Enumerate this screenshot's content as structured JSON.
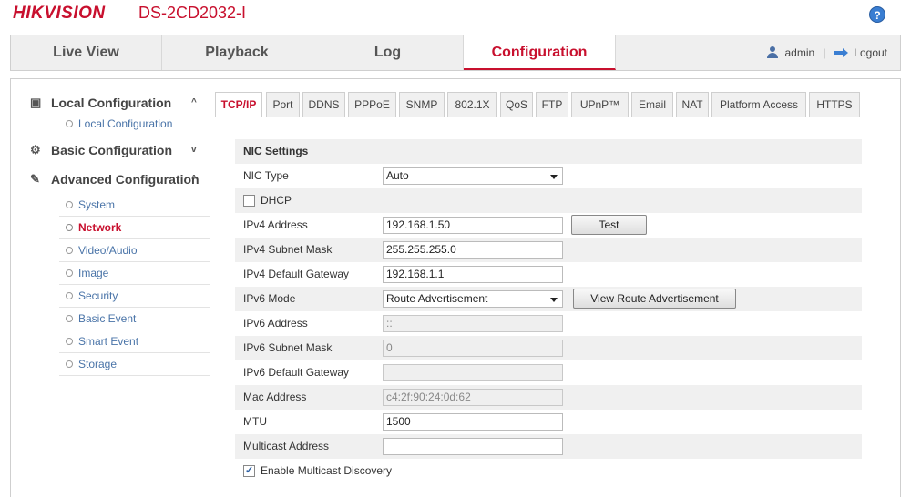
{
  "header": {
    "brand": "HIKVISION",
    "model": "DS-2CD2032-I",
    "help_label": "?"
  },
  "mainnav": {
    "tabs": [
      {
        "label": "Live View"
      },
      {
        "label": "Playback"
      },
      {
        "label": "Log"
      },
      {
        "label": "Configuration"
      }
    ],
    "user": "admin",
    "separator": "|",
    "logout": "Logout"
  },
  "sidebar": {
    "local": {
      "label": "Local Configuration",
      "chevron": "^",
      "items": [
        "Local Configuration"
      ]
    },
    "basic": {
      "label": "Basic Configuration",
      "chevron": "v"
    },
    "advanced": {
      "label": "Advanced Configuration",
      "chevron": "^",
      "items": [
        "System",
        "Network",
        "Video/Audio",
        "Image",
        "Security",
        "Basic Event",
        "Smart Event",
        "Storage"
      ]
    }
  },
  "subtabs": [
    "TCP/IP",
    "Port",
    "DDNS",
    "PPPoE",
    "SNMP",
    "802.1X",
    "QoS",
    "FTP",
    "UPnP™",
    "Email",
    "NAT",
    "Platform Access",
    "HTTPS"
  ],
  "form": {
    "section_title": "NIC Settings",
    "nic_type": {
      "label": "NIC Type",
      "value": "Auto"
    },
    "dhcp": {
      "label": "DHCP",
      "checked": false
    },
    "ipv4_address": {
      "label": "IPv4 Address",
      "value": "192.168.1.50",
      "button": "Test"
    },
    "ipv4_subnet": {
      "label": "IPv4 Subnet Mask",
      "value": "255.255.255.0"
    },
    "ipv4_gateway": {
      "label": "IPv4 Default Gateway",
      "value": "192.168.1.1"
    },
    "ipv6_mode": {
      "label": "IPv6 Mode",
      "value": "Route Advertisement",
      "button": "View Route Advertisement"
    },
    "ipv6_address": {
      "label": "IPv6 Address",
      "value": "::"
    },
    "ipv6_subnet": {
      "label": "IPv6 Subnet Mask",
      "value": "0"
    },
    "ipv6_gateway": {
      "label": "IPv6 Default Gateway",
      "value": ""
    },
    "mac_address": {
      "label": "Mac Address",
      "value": "c4:2f:90:24:0d:62"
    },
    "mtu": {
      "label": "MTU",
      "value": "1500"
    },
    "multicast": {
      "label": "Multicast Address",
      "value": ""
    },
    "multicast_discovery": {
      "label": "Enable Multicast Discovery",
      "checked": true
    }
  },
  "colors": {
    "brand": "#c8102e",
    "link": "#4a74a8",
    "accent": "#3a7ed2"
  }
}
